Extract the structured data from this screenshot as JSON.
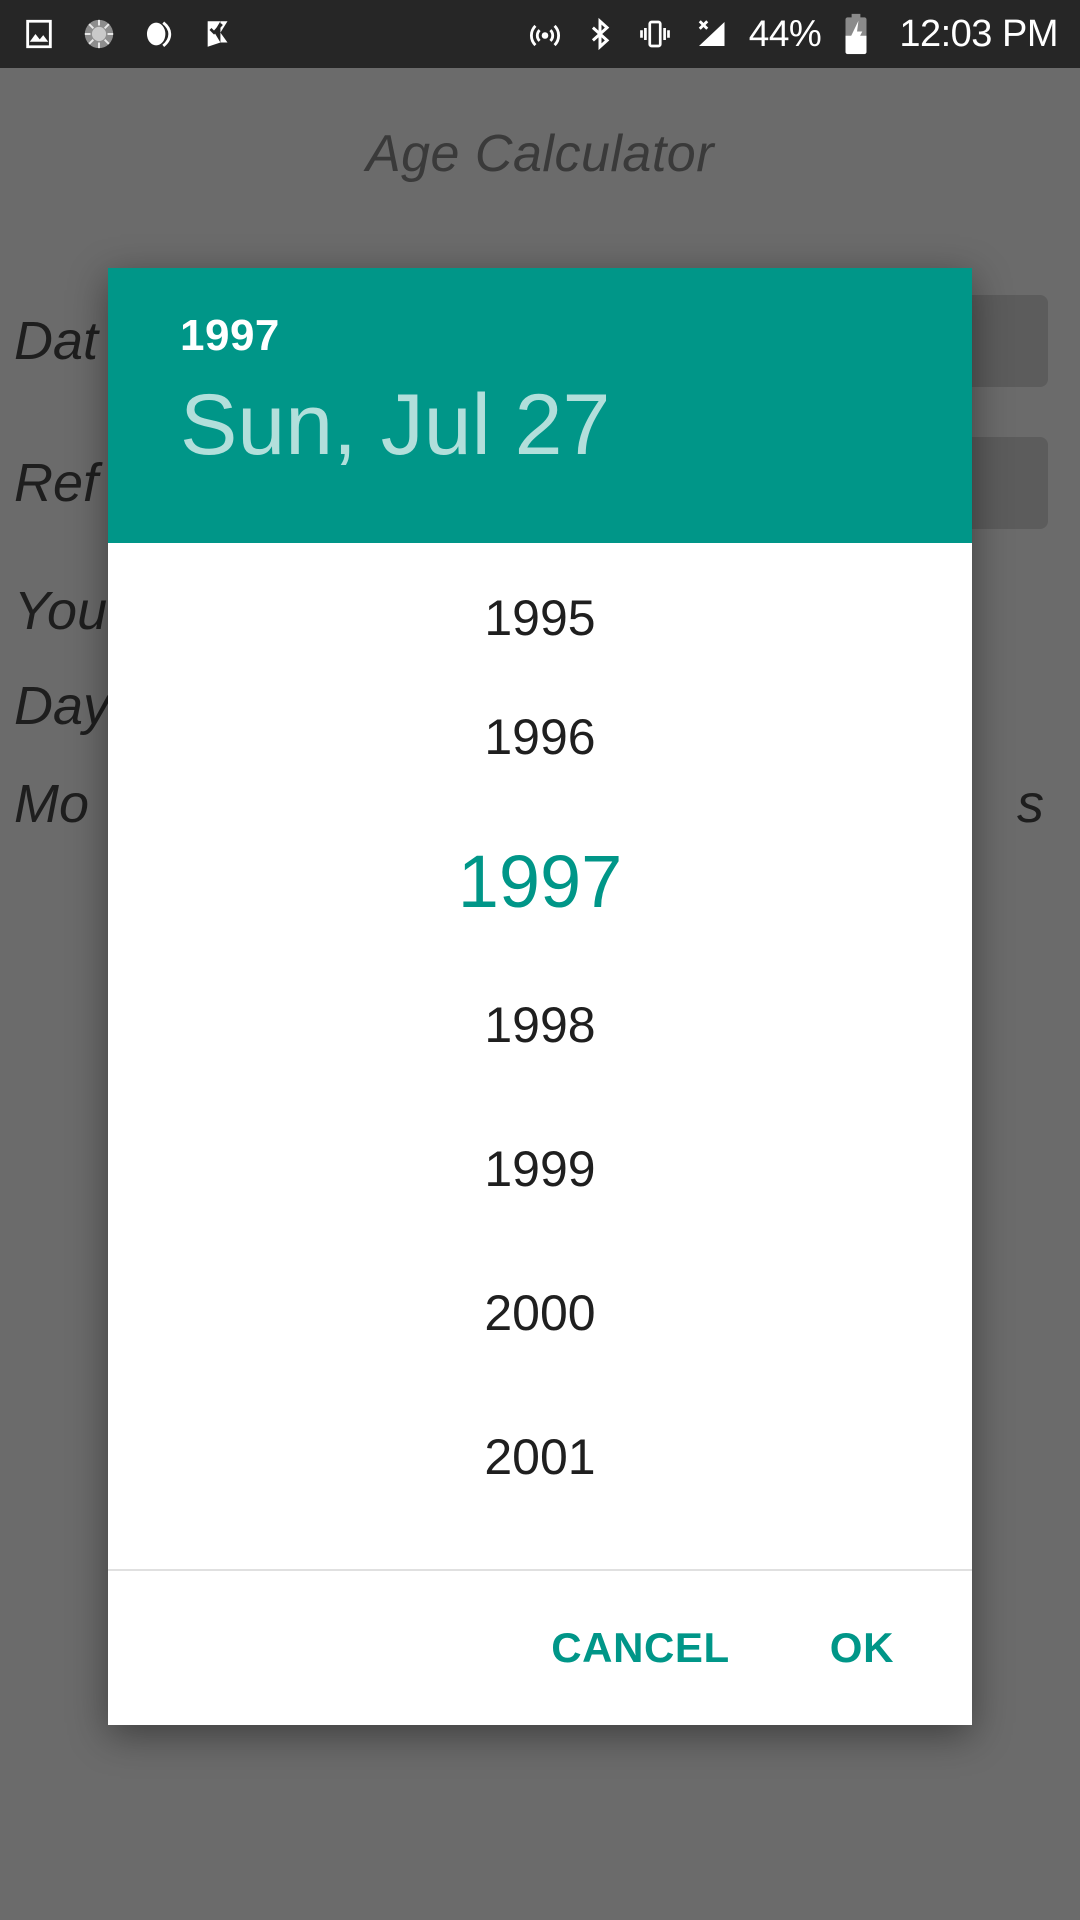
{
  "status_bar": {
    "background": "#262626",
    "battery_percent": "44%",
    "clock": "12:03 PM",
    "left_icons": [
      "image-icon",
      "sync-spinner-icon",
      "do-not-disturb-icon",
      "tasks-check-icon"
    ],
    "right_icons": [
      "cast-icon",
      "bluetooth-icon",
      "vibrate-icon",
      "no-signal-icon",
      "battery-charging-icon"
    ]
  },
  "app": {
    "title": "Age Calculator",
    "rows": [
      {
        "label": "Dat",
        "has_field": true
      },
      {
        "label": "Ref",
        "has_field": true
      },
      {
        "label": "You",
        "has_field": false
      },
      {
        "label": "Day",
        "has_field": false
      },
      {
        "label": "Mo",
        "has_field": false,
        "trailing": "s"
      }
    ]
  },
  "dialog": {
    "accent_color": "#009688",
    "header": {
      "year": "1997",
      "date": "Sun, Jul 27",
      "date_color": "#b2dfdb"
    },
    "year_picker": {
      "selected": "1997",
      "visible_years": [
        "1995",
        "1996",
        "1997",
        "1998",
        "1999",
        "2000",
        "2001"
      ]
    },
    "actions": {
      "cancel_label": "CANCEL",
      "ok_label": "OK"
    }
  }
}
